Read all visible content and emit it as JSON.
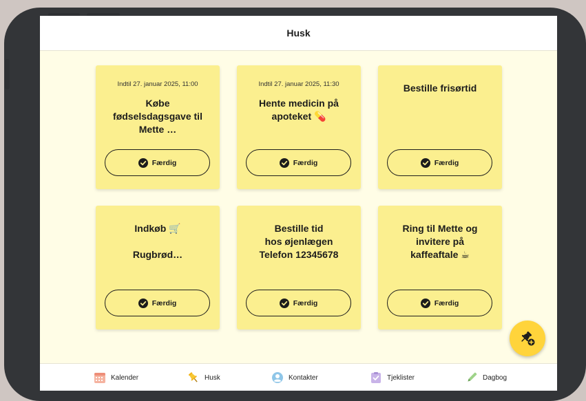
{
  "header": {
    "title": "Husk"
  },
  "notes": [
    {
      "date": "Indtil 27. januar 2025, 11:00",
      "text": "Købe\nfødselsdagsgave til\nMette …",
      "button": "Færdig"
    },
    {
      "date": "Indtil 27. januar 2025, 11:30",
      "text": "Hente medicin på\napoteket 💊",
      "button": "Færdig"
    },
    {
      "date": "",
      "text": "Bestille frisørtid",
      "button": "Færdig"
    },
    {
      "date": "",
      "text": "Indkøb 🛒\n\nRugbrød…",
      "button": "Færdig"
    },
    {
      "date": "",
      "text": "Bestille tid\nhos øjenlægen\nTelefon 12345678",
      "button": "Færdig"
    },
    {
      "date": "",
      "text": "Ring til Mette og\ninvitere på\nkaffeaftale ☕",
      "button": "Færdig"
    }
  ],
  "nav": [
    {
      "label": "Kalender",
      "icon": "calendar-icon"
    },
    {
      "label": "Husk",
      "icon": "pin-icon"
    },
    {
      "label": "Kontakter",
      "icon": "contacts-icon"
    },
    {
      "label": "Tjeklister",
      "icon": "checklist-icon"
    },
    {
      "label": "Dagbog",
      "icon": "pencil-icon"
    }
  ],
  "colors": {
    "note": "#fbef8f",
    "fab": "#ffd43b",
    "background": "#fffde6"
  }
}
